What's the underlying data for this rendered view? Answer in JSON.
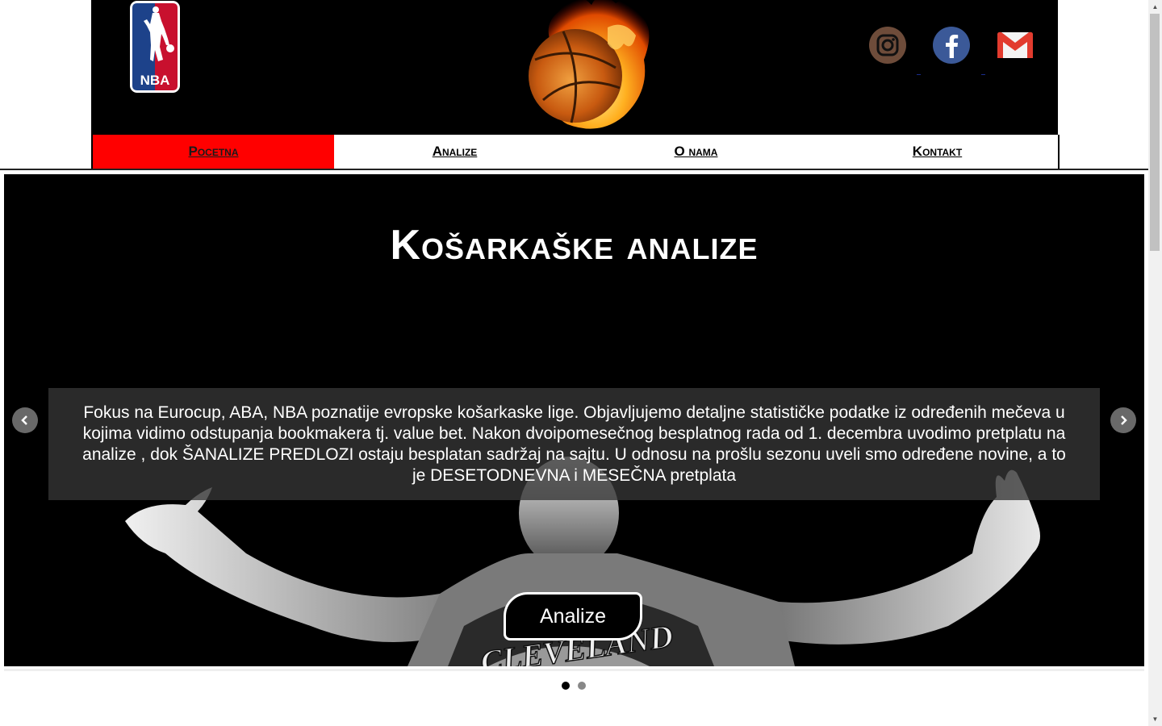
{
  "header": {
    "logo_text": "NBA",
    "social": [
      {
        "name": "instagram-icon"
      },
      {
        "name": "facebook-icon"
      },
      {
        "name": "gmail-icon"
      }
    ]
  },
  "nav": {
    "items": [
      {
        "label": "Pocetna",
        "active": true
      },
      {
        "label": "Analize",
        "active": false
      },
      {
        "label": "O nama",
        "active": false
      },
      {
        "label": "Kontakt",
        "active": false
      }
    ]
  },
  "hero": {
    "title": "Košarkaške analize",
    "caption": "Fokus na Eurocup, ABA, NBA poznatije evropske košarkaske lige. Objavljujemo detaljne statističke podatke iz određenih mečeva u kojima vidimo odstupanja bookmakera tj. value bet. Nakon dvoipomesečnog besplatnog rada od 1. decembra uvodimo pretplatu na analize , dok ŠANALIZE PREDLOZI ostaju besplatan sadržaj na sajtu. U odnosu na prošlu sezonu uveli smo određene novine, a to je DESETODNEVNA i MESEČNA pretplata",
    "button_label": "Analize",
    "jersey_text": "CLEVELAND"
  },
  "carousel": {
    "slide_count": 2,
    "active_index": 0
  },
  "colors": {
    "nav_active": "#ff0000",
    "header_bg": "#000000",
    "caption_bg": "#363636"
  }
}
